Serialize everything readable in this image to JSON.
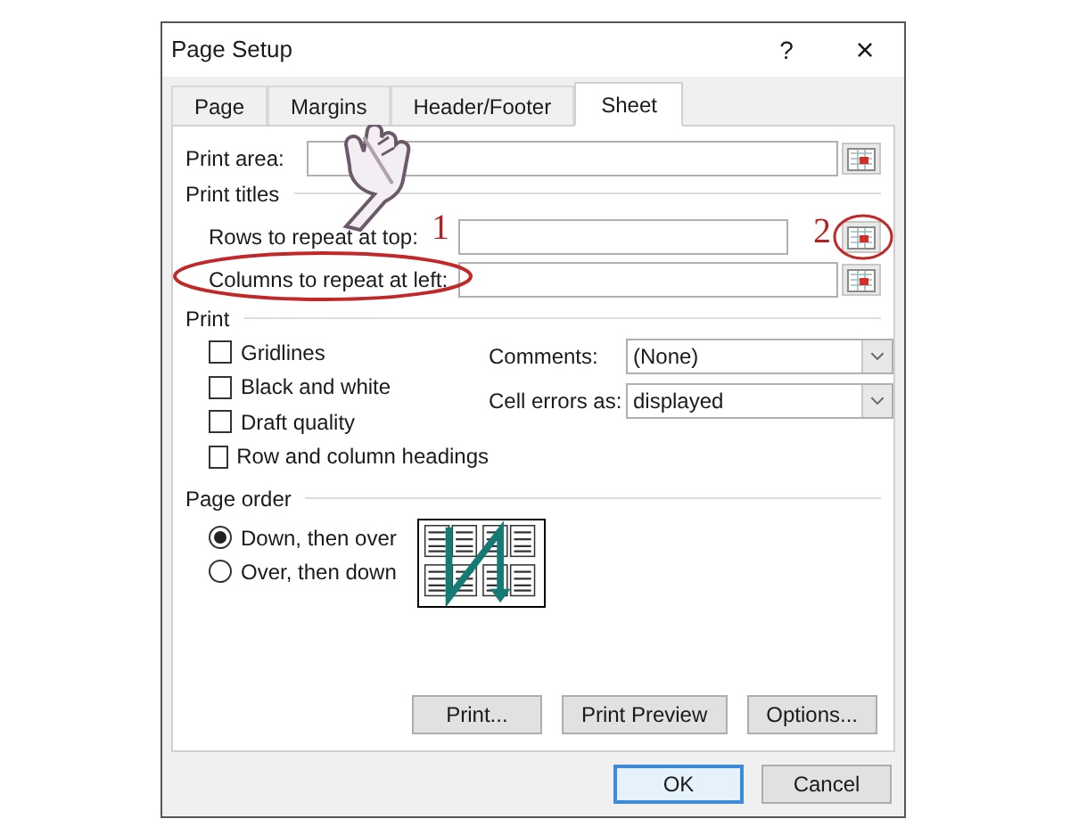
{
  "window": {
    "title": "Page Setup",
    "help": "?",
    "close": "×"
  },
  "tabs": [
    {
      "label": "Page",
      "selected": false
    },
    {
      "label": "Margins",
      "selected": false
    },
    {
      "label": "Header/Footer",
      "selected": false
    },
    {
      "label": "Sheet",
      "selected": true
    }
  ],
  "print_area": {
    "label": "Print area:",
    "pointer": true
  },
  "print_titles": {
    "label": "Print titles",
    "fields": [
      {
        "label": "Rows to repeat at top:",
        "marker": "1",
        "button_marker": "2",
        "button_circled": true,
        "label_circled": false
      },
      {
        "label": "Columns to repeat at left:",
        "label_circled": true,
        "button_circled": false
      }
    ]
  },
  "print": {
    "label": "Print",
    "options": [
      {
        "label": "Gridlines",
        "checked": false
      },
      {
        "label": "Black and white",
        "checked": false
      },
      {
        "label": "Draft quality",
        "checked": false
      },
      {
        "label": "Row and column headings",
        "checked": false
      }
    ],
    "selects": [
      {
        "label": "Comments:",
        "value": "(None)"
      },
      {
        "label": "Cell errors as:",
        "value": "displayed"
      }
    ]
  },
  "page_order": {
    "label": "Page order",
    "options": [
      {
        "label": "Down, then over",
        "selected": true
      },
      {
        "label": "Over, then down",
        "selected": false
      }
    ]
  },
  "action_buttons": [
    "Print...",
    "Print Preview",
    "Options..."
  ],
  "dialog_buttons": [
    {
      "label": "OK",
      "default": true
    },
    {
      "label": "Cancel",
      "default": false
    }
  ]
}
